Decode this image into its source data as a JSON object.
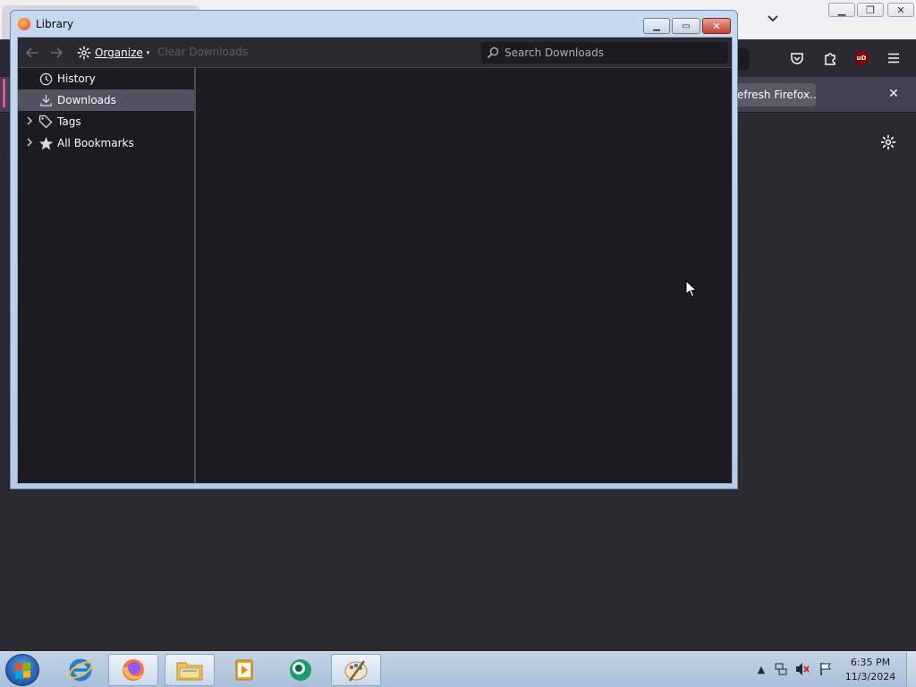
{
  "browser": {
    "notification": {
      "refresh_button": "efresh Firefox…"
    },
    "ublock_badge": "uD"
  },
  "library": {
    "title": "Library",
    "toolbar": {
      "organize_label": "Organize",
      "clear_downloads_label": "Clear Downloads",
      "search_placeholder": "Search Downloads",
      "search_value": ""
    },
    "sidebar": {
      "items": [
        {
          "label": "History",
          "icon": "clock-icon",
          "expandable": false,
          "selected": false
        },
        {
          "label": "Downloads",
          "icon": "download-icon",
          "expandable": false,
          "selected": true
        },
        {
          "label": "Tags",
          "icon": "tag-icon",
          "expandable": true,
          "selected": false
        },
        {
          "label": "All Bookmarks",
          "icon": "star-icon",
          "expandable": true,
          "selected": false
        }
      ]
    }
  },
  "taskbar": {
    "apps": [
      "internet-explorer",
      "firefox",
      "windows-explorer",
      "media-player",
      "app5",
      "paint"
    ],
    "active_app": "firefox",
    "clock": {
      "time": "6:35 PM",
      "date": "11/3/2024"
    }
  },
  "colors": {
    "browser_bg": "#2b2a33",
    "library_panel_bg": "#1c1b22",
    "selected_row": "#52525e",
    "window_frame": "#c6d9ee",
    "close_button": "#c7402d"
  }
}
